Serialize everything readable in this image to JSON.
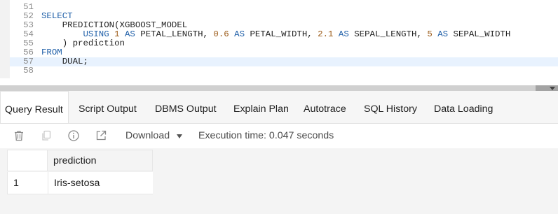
{
  "editor": {
    "lines": [
      {
        "num": "51",
        "active": false,
        "indent": "",
        "tokens": []
      },
      {
        "num": "52",
        "active": false,
        "indent": "",
        "tokens": [
          {
            "t": "kw",
            "v": "SELECT"
          }
        ]
      },
      {
        "num": "53",
        "active": false,
        "indent": "    ",
        "tokens": [
          {
            "t": "plain",
            "v": "PREDICTION(XGBOOST_MODEL"
          }
        ]
      },
      {
        "num": "54",
        "active": false,
        "indent": "        ",
        "tokens": [
          {
            "t": "kw",
            "v": "USING"
          },
          {
            "t": "plain",
            "v": " "
          },
          {
            "t": "num",
            "v": "1"
          },
          {
            "t": "plain",
            "v": " "
          },
          {
            "t": "kw",
            "v": "AS"
          },
          {
            "t": "plain",
            "v": " PETAL_LENGTH, "
          },
          {
            "t": "num",
            "v": "0.6"
          },
          {
            "t": "plain",
            "v": " "
          },
          {
            "t": "kw",
            "v": "AS"
          },
          {
            "t": "plain",
            "v": " PETAL_WIDTH, "
          },
          {
            "t": "num",
            "v": "2.1"
          },
          {
            "t": "plain",
            "v": " "
          },
          {
            "t": "kw",
            "v": "AS"
          },
          {
            "t": "plain",
            "v": " SEPAL_LENGTH, "
          },
          {
            "t": "num",
            "v": "5"
          },
          {
            "t": "plain",
            "v": " "
          },
          {
            "t": "kw",
            "v": "AS"
          },
          {
            "t": "plain",
            "v": " SEPAL_WIDTH"
          }
        ]
      },
      {
        "num": "55",
        "active": false,
        "indent": "    ",
        "tokens": [
          {
            "t": "plain",
            "v": ") prediction"
          }
        ]
      },
      {
        "num": "56",
        "active": false,
        "indent": "",
        "tokens": [
          {
            "t": "kw",
            "v": "FROM"
          }
        ]
      },
      {
        "num": "57",
        "active": true,
        "indent": "    ",
        "tokens": [
          {
            "t": "plain",
            "v": "DUAL;"
          }
        ]
      },
      {
        "num": "58",
        "active": false,
        "indent": "",
        "tokens": []
      }
    ]
  },
  "tabs": [
    {
      "label": "Query Result",
      "active": true
    },
    {
      "label": "Script Output",
      "active": false
    },
    {
      "label": "DBMS Output",
      "active": false
    },
    {
      "label": "Explain Plan",
      "active": false
    },
    {
      "label": "Autotrace",
      "active": false
    },
    {
      "label": "SQL History",
      "active": false
    },
    {
      "label": "Data Loading",
      "active": false
    }
  ],
  "toolbar": {
    "icons": [
      "trash-icon",
      "copy-icon",
      "info-icon",
      "open-in-new-icon"
    ],
    "download_label": "Download",
    "execution_time": "Execution time: 0.047 seconds"
  },
  "results": {
    "columns": [
      "prediction"
    ],
    "rows": [
      {
        "num": "1",
        "cells": [
          "Iris-setosa"
        ]
      }
    ]
  },
  "colors": {
    "keyword": "#1f5fa8",
    "number": "#9b5a17",
    "active_line": "#e8f2fe"
  }
}
